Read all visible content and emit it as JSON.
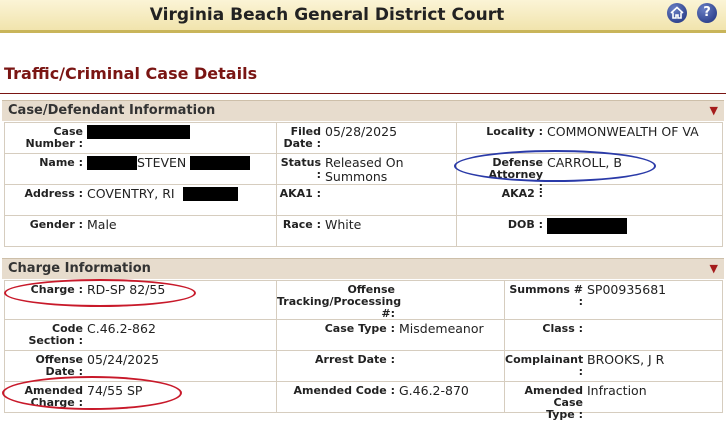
{
  "header": {
    "title": "Virginia Beach General District Court",
    "home_icon": "home-icon",
    "help_icon": "help-icon",
    "help_glyph": "?"
  },
  "page_title": "Traffic/Criminal Case Details",
  "case_section": {
    "title": "Case/Defendant Information",
    "case_number_label": "Case Number :",
    "filed_date_label": "Filed Date :",
    "filed_date": "05/28/2025",
    "locality_label": "Locality :",
    "locality": "COMMONWEALTH OF VA",
    "name_label": "Name :",
    "name_visible": "STEVEN",
    "status_label": "Status :",
    "status": "Released On Summons",
    "defense_attorney_label": "Defense Attorney :",
    "defense_attorney": "CARROLL, B",
    "address_label": "Address :",
    "address": "COVENTRY, RI",
    "aka1_label": "AKA1 :",
    "aka2_label": "AKA2 :",
    "gender_label": "Gender :",
    "gender": "Male",
    "race_label": "Race :",
    "race": "White",
    "dob_label": "DOB :"
  },
  "charge_section": {
    "title": "Charge Information",
    "charge_label": "Charge :",
    "charge": "RD-SP 82/55",
    "otn_label": "Offense Tracking/Processing #:",
    "summons_label": "Summons # :",
    "summons": "SP00935681",
    "code_section_label": "Code Section :",
    "code_section": "C.46.2-862",
    "case_type_label": "Case Type :",
    "case_type": "Misdemeanor",
    "class_label": "Class :",
    "offense_date_label": "Offense Date :",
    "offense_date": "05/24/2025",
    "arrest_date_label": "Arrest Date :",
    "complainant_label": "Complainant :",
    "complainant": "BROOKS, J R",
    "amended_charge_label": "Amended Charge :",
    "amended_charge": "74/55 SP",
    "amended_code_label": "Amended Code :",
    "amended_code": "G.46.2-870",
    "amended_case_type_label": "Amended Case Type :",
    "amended_case_type": "Infraction"
  },
  "colors": {
    "accent_red": "#7a1513",
    "annotation_red": "#c8192a",
    "annotation_blue": "#2a3aa8"
  }
}
